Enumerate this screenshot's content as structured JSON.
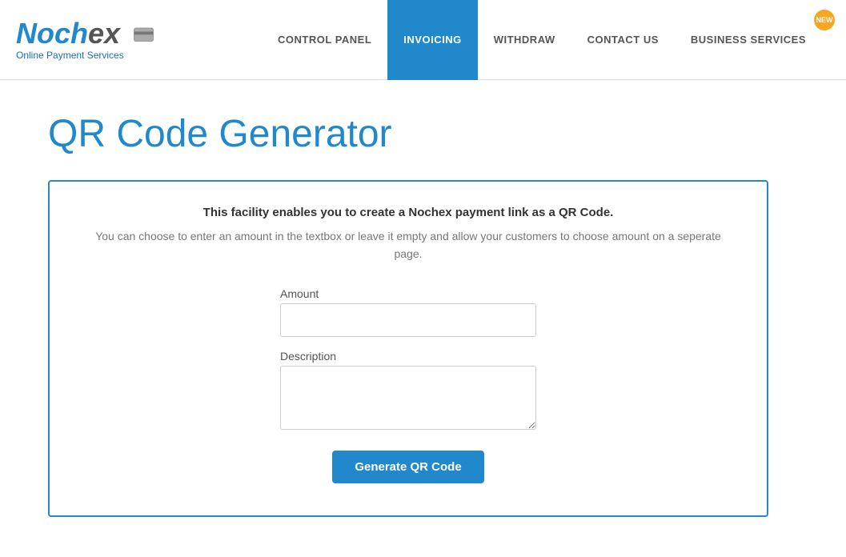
{
  "logo": {
    "brand": "Nochex",
    "tagline": "Online Payment Services"
  },
  "nav": {
    "items": [
      {
        "label": "CONTROL PANEL",
        "active": false,
        "new": false
      },
      {
        "label": "INVOICING",
        "active": true,
        "new": false
      },
      {
        "label": "WITHDRAW",
        "active": false,
        "new": false
      },
      {
        "label": "CONTACT US",
        "active": false,
        "new": false
      },
      {
        "label": "BUSINESS SERVICES",
        "active": false,
        "new": true
      }
    ]
  },
  "page": {
    "title": "QR Code Generator",
    "panel": {
      "bold_line": "This facility enables you to create a Nochex payment link as a QR Code.",
      "normal_line": "You can choose to enter an amount in the textbox or leave it empty and allow your customers to choose amount on a seperate page.",
      "amount_label": "Amount",
      "description_label": "Description",
      "amount_placeholder": "",
      "description_placeholder": "",
      "button_label": "Generate QR Code",
      "new_badge": "NEW"
    }
  }
}
